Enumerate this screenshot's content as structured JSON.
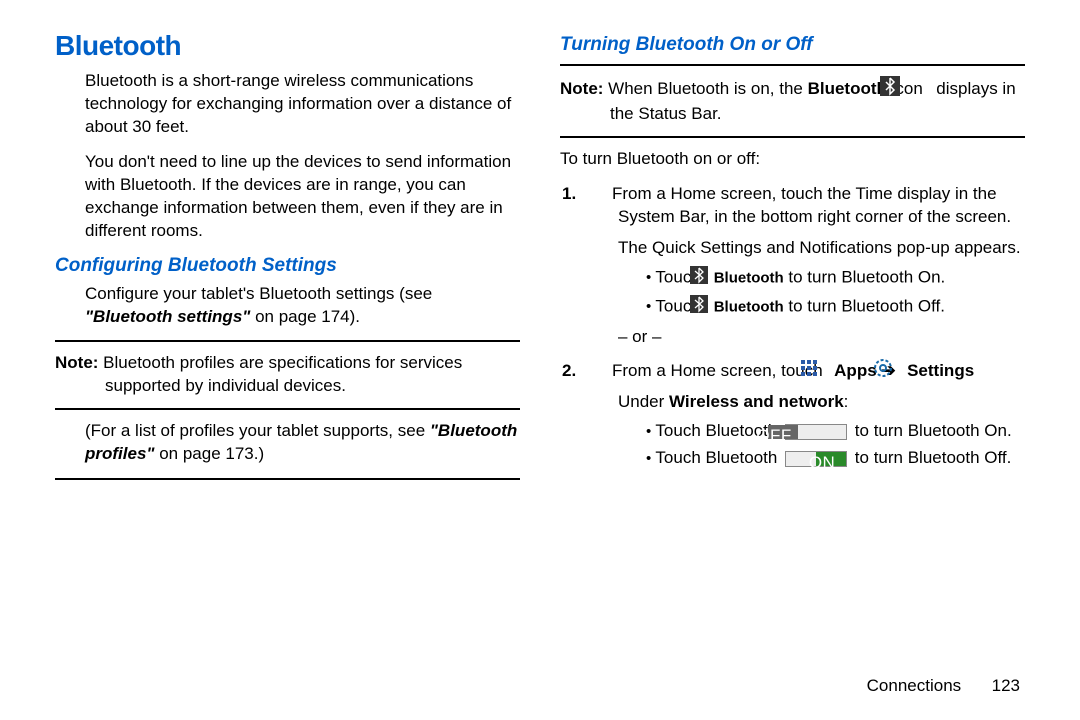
{
  "left": {
    "title": "Bluetooth",
    "p1": "Bluetooth is a short-range wireless communications technology for exchanging information over a distance of about 30 feet.",
    "p2": "You don't need to line up the devices to send information with Bluetooth. If the devices are in range, you can exchange information between them, even if they are in different rooms.",
    "h2": "Configuring Bluetooth Settings",
    "configure_pre": "Configure your tablet's Bluetooth settings (see ",
    "configure_ref": "\"Bluetooth settings\"",
    "configure_post": " on page 174).",
    "note_label": "Note:",
    "note_text": " Bluetooth profiles are specifications for services supported by individual devices.",
    "profiles_pre": "(For a list of profiles your tablet supports, see ",
    "profiles_ref": "\"Bluetooth profiles\"",
    "profiles_post": " on page 173.)"
  },
  "right": {
    "h2": "Turning Bluetooth On or Off",
    "note_label": "Note:",
    "note_pre": " When Bluetooth is on, the ",
    "note_bold": "Bluetooth",
    "note_mid": " icon ",
    "note_post": " displays in the Status Bar.",
    "intro": "To turn Bluetooth on or off:",
    "step1_n": "1.",
    "step1_a": "From a Home screen, touch the Time display in the System Bar, in the bottom right corner of the screen.",
    "step1_b": "The Quick Settings and Notifications pop-up appears.",
    "bullet1_pre": "Touch ",
    "bullet1_bold": "Bluetooth",
    "bullet1_post": " to turn Bluetooth On.",
    "bullet2_pre": "Touch ",
    "bullet2_bold": "Bluetooth",
    "bullet2_post": " to turn Bluetooth Off.",
    "or": "– or –",
    "step2_n": "2.",
    "step2_pre": "From a Home screen, touch ",
    "step2_apps": "Apps",
    "step2_arrow": " ➔ ",
    "step2_settings": "Settings",
    "step2_line2_pre": "Under ",
    "step2_line2_bold": "Wireless and network",
    "step2_line2_post": ":",
    "bullet3_pre": "Touch Bluetooth ",
    "bullet3_post": " to turn Bluetooth On.",
    "bullet4_pre": "Touch Bluetooth ",
    "bullet4_post": " to turn Bluetooth Off.",
    "off_label": "OFF",
    "on_label": "ON"
  },
  "footer": {
    "section": "Connections",
    "page": "123"
  }
}
